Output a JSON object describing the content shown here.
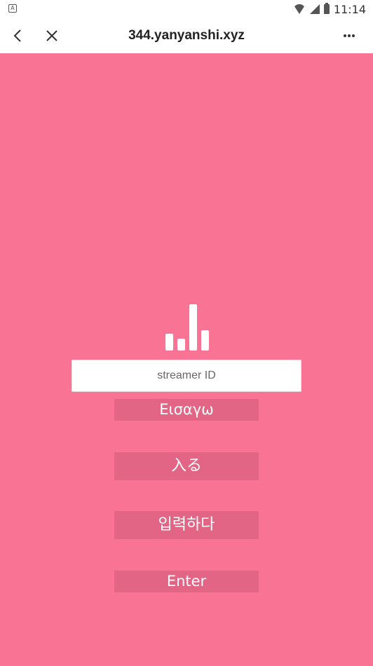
{
  "status_bar": {
    "left_badge": "A",
    "time": "11:14",
    "icons": [
      "wifi-icon",
      "signal-icon",
      "battery-icon"
    ]
  },
  "browser_bar": {
    "title": "344.yanyanshi.xyz",
    "back_icon": "chevron-left-icon",
    "close_icon": "close-icon",
    "menu_icon": "more-horizontal-icon"
  },
  "login": {
    "logo_icon": "bar-chart-icon",
    "input_placeholder": "streamer ID",
    "input_value": "",
    "buttons": [
      {
        "label": "Εισαγω",
        "lang": "el"
      },
      {
        "label": "入る",
        "lang": "ja"
      },
      {
        "label": "입력하다",
        "lang": "ko"
      },
      {
        "label": "Enter",
        "lang": "en"
      }
    ]
  },
  "colors": {
    "background": "#f87394",
    "button": "#e36586",
    "bar_background": "#ffffff"
  }
}
